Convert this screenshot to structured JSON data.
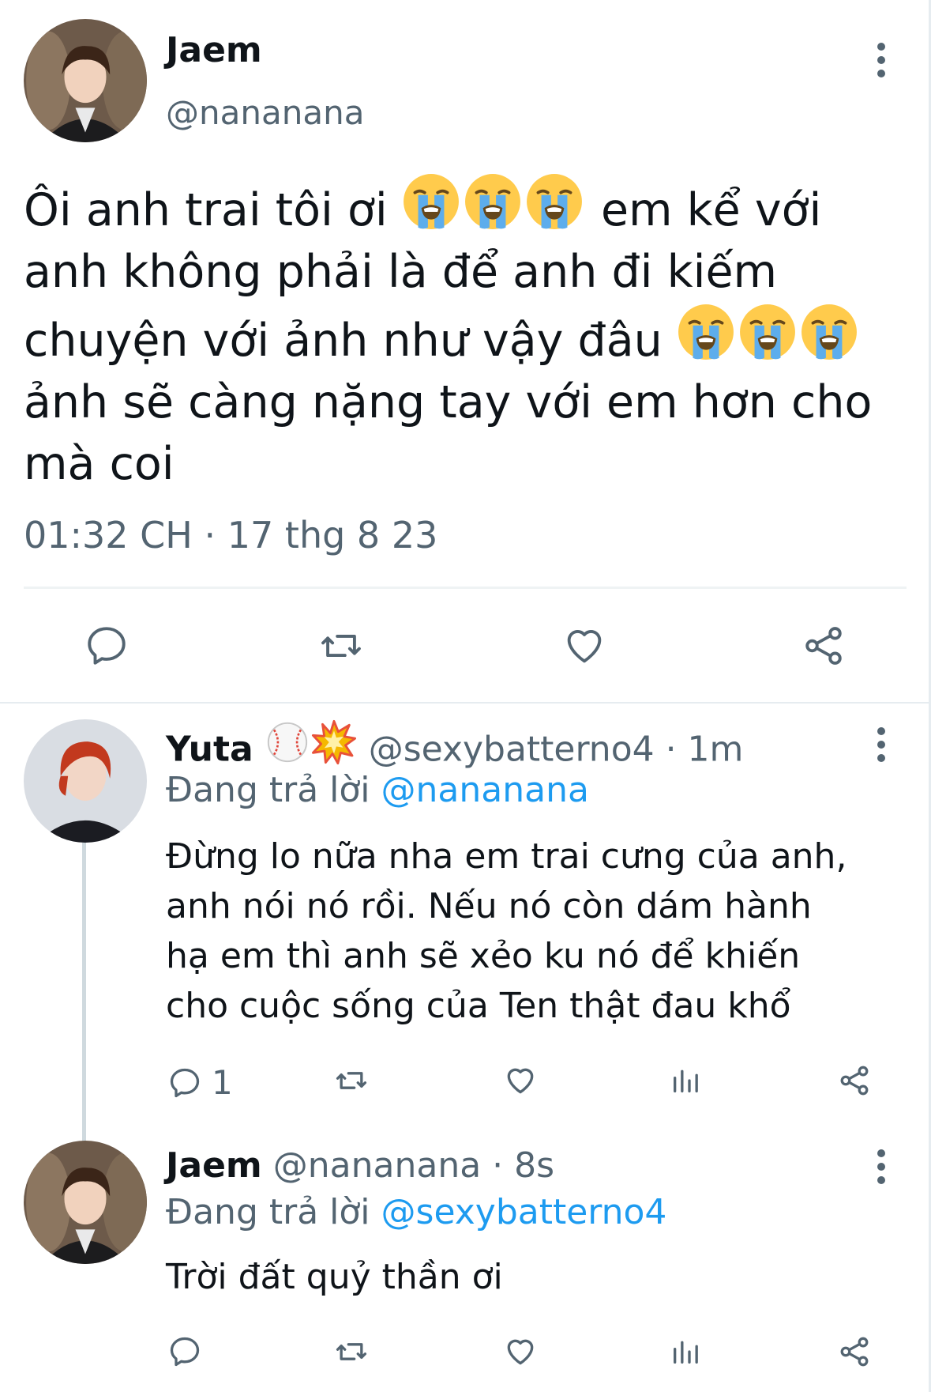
{
  "main_tweet": {
    "display_name": "Jaem",
    "handle": "@nananana",
    "text_line1": "Ôi anh trai tôi ơi",
    "text_line1b": "em kể với",
    "text_line2": "anh không phải là để anh đi kiếm",
    "text_line3": "chuyện với ảnh như vậy đâu",
    "text_line4": "ảnh sẽ càng nặng tay với em hơn cho",
    "text_line5": "mà coi",
    "emoji": "loudly-crying-face",
    "timestamp": "01:32 CH · 17 thg 8 23"
  },
  "reply1": {
    "display_name": "Yuta",
    "name_emojis": [
      "baseball",
      "collision"
    ],
    "handle_time": "@sexybatterno4 · 1m",
    "replying_prefix": "Đang trả lời",
    "replying_to": "@nananana",
    "line1": "Đừng lo nữa nha em trai cưng của anh,",
    "line2": "anh nói nó rồi. Nếu nó còn dám hành",
    "line3": "hạ em thì anh sẽ xẻo ku nó để khiến",
    "line4": "cho cuộc sống của Ten thật đau khổ",
    "reply_count": "1"
  },
  "reply2": {
    "display_name": "Jaem",
    "handle_time": "@nananana · 8s",
    "replying_prefix": "Đang trả lời",
    "replying_to": "@sexybatterno4",
    "text": "Trời đất quỷ thần ơi"
  },
  "colors": {
    "text": "#0f1419",
    "secondary": "#536471",
    "link": "#1d9bf0",
    "divider": "#eff3f4"
  }
}
